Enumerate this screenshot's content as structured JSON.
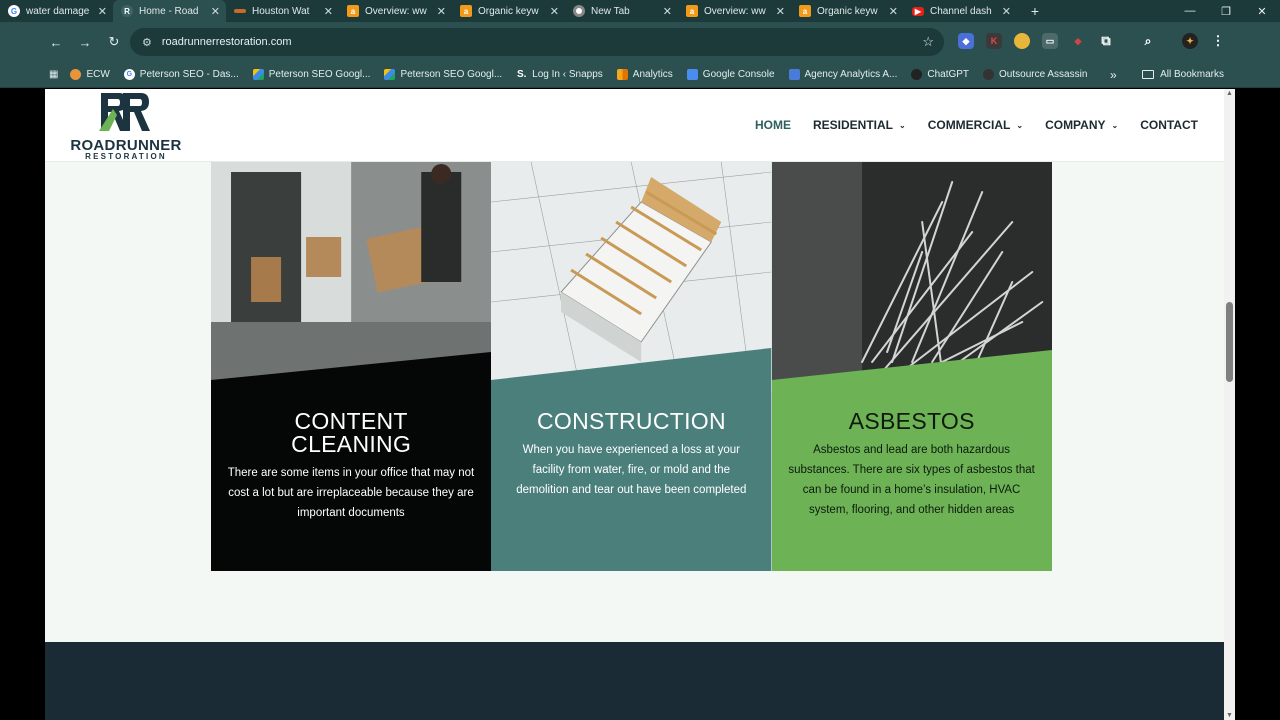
{
  "browser": {
    "tabs": [
      {
        "title": "water damage",
        "icon": "google-icon",
        "color": "#ffffff",
        "active": false
      },
      {
        "title": "Home - Road",
        "icon": "roadrunner-icon",
        "color": "#2c4f4f",
        "active": true
      },
      {
        "title": "Houston Wat",
        "icon": "site-icon",
        "color": "#c86b2a",
        "active": false
      },
      {
        "title": "Overview: ww",
        "icon": "ahrefs-icon",
        "color": "#f29a1a",
        "active": false
      },
      {
        "title": "Organic keyw",
        "icon": "ahrefs-icon",
        "color": "#f29a1a",
        "active": false
      },
      {
        "title": "New Tab",
        "icon": "chrome-icon",
        "color": "#ffffff",
        "active": false
      },
      {
        "title": "Overview: ww",
        "icon": "ahrefs-icon",
        "color": "#f29a1a",
        "active": false
      },
      {
        "title": "Organic keyw",
        "icon": "ahrefs-icon",
        "color": "#f29a1a",
        "active": false
      },
      {
        "title": "Channel dash",
        "icon": "youtube-icon",
        "color": "#e62117",
        "active": false
      }
    ],
    "url": "roadrunnerrestoration.com",
    "bookmarks": [
      {
        "label": "ECW",
        "icon": "ecw-icon",
        "color": "#e8943a"
      },
      {
        "label": "Peterson SEO - Das...",
        "icon": "google-icon",
        "color": "#ffffff"
      },
      {
        "label": "Peterson SEO Googl...",
        "icon": "drive-icon",
        "color": "#3c8ce7"
      },
      {
        "label": "Peterson SEO Googl...",
        "icon": "drive-icon",
        "color": "#3c8ce7"
      },
      {
        "label": "Log In ‹ Snapps",
        "icon": "snapps-icon",
        "color": "#2c4f4f"
      },
      {
        "label": "Analytics",
        "icon": "analytics-icon",
        "color": "#f4a91c"
      },
      {
        "label": "Google Console",
        "icon": "search-console-icon",
        "color": "#4a8df0"
      },
      {
        "label": "Agency Analytics A...",
        "icon": "agency-icon",
        "color": "#4a7bd8"
      },
      {
        "label": "ChatGPT",
        "icon": "chatgpt-icon",
        "color": "#222222"
      },
      {
        "label": "Outsource Assassin",
        "icon": "assassin-icon",
        "color": "#333333"
      }
    ],
    "all_bookmarks": "All Bookmarks"
  },
  "site": {
    "logo_name": "ROADRUNNER",
    "logo_sub": "RESTORATION",
    "nav": [
      {
        "label": "HOME",
        "has_dropdown": false
      },
      {
        "label": "RESIDENTIAL",
        "has_dropdown": true
      },
      {
        "label": "COMMERCIAL",
        "has_dropdown": true
      },
      {
        "label": "COMPANY",
        "has_dropdown": true
      },
      {
        "label": "CONTACT",
        "has_dropdown": false
      }
    ],
    "cards": [
      {
        "title_line1": "CONTENT",
        "title_line2": "CLEANING",
        "text": "There are some items in your office that may not cost a lot but are irreplaceable because they are important documents",
        "band_color": "#050707",
        "title_color": "#ffffff",
        "text_color": "#ffffff"
      },
      {
        "title_line1": "CONSTRUCTION",
        "title_line2": "",
        "text": "When you have experienced a loss at your facility from water, fire, or mold and the demolition and tear out have been completed",
        "band_color": "#4a7f7c",
        "title_color": "#ffffff",
        "text_color": "#ffffff"
      },
      {
        "title_line1": "ASBESTOS",
        "title_line2": "",
        "text": "Asbestos and lead are both hazardous substances. There are six types of asbestos that can be found in a home’s insulation, HVAC system, flooring, and other hidden areas",
        "band_color": "#6db356",
        "title_color": "#0e1a0e",
        "text_color": "#0e1a0e"
      }
    ],
    "footer_color": "#1a2b36"
  }
}
